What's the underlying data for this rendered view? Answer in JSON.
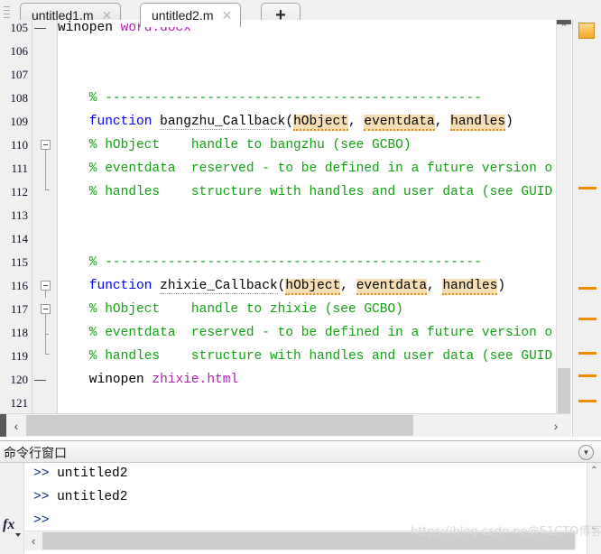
{
  "tabs": {
    "items": [
      {
        "label": "untitled1.m",
        "active": false,
        "close": "✕"
      },
      {
        "label": "untitled2.m",
        "active": true,
        "close": "✕"
      }
    ],
    "add_label": "+"
  },
  "editor": {
    "lines": [
      {
        "number": "105",
        "exec": "—",
        "clipped": true,
        "tokens": [
          {
            "t": "winopen ",
            "c": "plain"
          },
          {
            "t": "word.docx",
            "c": "str"
          }
        ]
      },
      {
        "number": "106",
        "exec": "",
        "tokens": []
      },
      {
        "number": "107",
        "exec": "",
        "tokens": []
      },
      {
        "number": "108",
        "exec": "",
        "tokens": [
          {
            "t": "    % ------------------------------------------------",
            "c": "cm"
          }
        ]
      },
      {
        "number": "109",
        "exec": "",
        "tokens": [
          {
            "t": "    ",
            "c": "plain"
          },
          {
            "t": "function",
            "c": "kw"
          },
          {
            "t": " ",
            "c": "plain"
          },
          {
            "t": "bangzhu_Callback",
            "c": "fn"
          },
          {
            "t": "(",
            "c": "plain"
          },
          {
            "t": "hObject",
            "c": "hl"
          },
          {
            "t": ", ",
            "c": "plain"
          },
          {
            "t": "eventdata",
            "c": "hl"
          },
          {
            "t": ", ",
            "c": "plain"
          },
          {
            "t": "handles",
            "c": "hl"
          },
          {
            "t": ")",
            "c": "plain"
          }
        ]
      },
      {
        "number": "110",
        "exec": "",
        "tokens": [
          {
            "t": "    % hObject    handle to bangzhu (see GCBO)",
            "c": "cm"
          }
        ]
      },
      {
        "number": "111",
        "exec": "",
        "tokens": [
          {
            "t": "    % eventdata  reserved - to be defined in a future version o",
            "c": "cm"
          }
        ]
      },
      {
        "number": "112",
        "exec": "",
        "tokens": [
          {
            "t": "    % handles    structure with handles and user data (see GUID.",
            "c": "cm"
          }
        ]
      },
      {
        "number": "113",
        "exec": "",
        "tokens": []
      },
      {
        "number": "114",
        "exec": "",
        "tokens": []
      },
      {
        "number": "115",
        "exec": "",
        "tokens": [
          {
            "t": "    % ------------------------------------------------",
            "c": "cm"
          }
        ]
      },
      {
        "number": "116",
        "exec": "",
        "tokens": [
          {
            "t": "    ",
            "c": "plain"
          },
          {
            "t": "function",
            "c": "kw"
          },
          {
            "t": " ",
            "c": "plain"
          },
          {
            "t": "zhixie_Callback",
            "c": "fn"
          },
          {
            "t": "(",
            "c": "plain"
          },
          {
            "t": "hObject",
            "c": "hl"
          },
          {
            "t": ", ",
            "c": "plain"
          },
          {
            "t": "eventdata",
            "c": "hl"
          },
          {
            "t": ", ",
            "c": "plain"
          },
          {
            "t": "handles",
            "c": "hl"
          },
          {
            "t": ")",
            "c": "plain"
          }
        ]
      },
      {
        "number": "117",
        "exec": "",
        "tokens": [
          {
            "t": "    % hObject    handle to zhixie (see GCBO)",
            "c": "cm"
          }
        ]
      },
      {
        "number": "118",
        "exec": "",
        "tokens": [
          {
            "t": "    % eventdata  reserved - to be defined in a future version o",
            "c": "cm"
          }
        ]
      },
      {
        "number": "119",
        "exec": "",
        "tokens": [
          {
            "t": "    % handles    structure with handles and user data (see GUID.",
            "c": "cm"
          }
        ]
      },
      {
        "number": "120",
        "exec": "—",
        "tokens": [
          {
            "t": "    winopen ",
            "c": "plain"
          },
          {
            "t": "zhixie.html",
            "c": "str"
          }
        ]
      },
      {
        "number": "121",
        "exec": "",
        "tokens": []
      }
    ],
    "hscroll": {
      "left_arrow": "‹",
      "right_arrow": "›"
    },
    "vscroll": {
      "up_arrow": "⌃",
      "down_arrow": "⌄"
    },
    "marker_strip": {
      "status_tooltip": "code-analyzer-warning"
    }
  },
  "command_window": {
    "title": "命令行窗口",
    "menu_icon": "▼",
    "fx_label": "fx",
    "lines": [
      {
        "prompt": ">>",
        "text": " untitled2"
      },
      {
        "prompt": ">>",
        "text": " untitled2"
      },
      {
        "prompt": ">>",
        "text": ""
      }
    ],
    "hscroll": {
      "left_arrow": "‹"
    },
    "vscroll": {
      "up_arrow": "⌃",
      "down_arrow": "⌄"
    }
  },
  "watermark": {
    "text": "https://blog.csdn.ne@51CTO博客"
  },
  "colors": {
    "keyword": "#0000ff",
    "comment": "#14a014",
    "string": "#b020b0",
    "highlight_bg": "#f5deb3",
    "marker_orange": "#f08c00"
  }
}
